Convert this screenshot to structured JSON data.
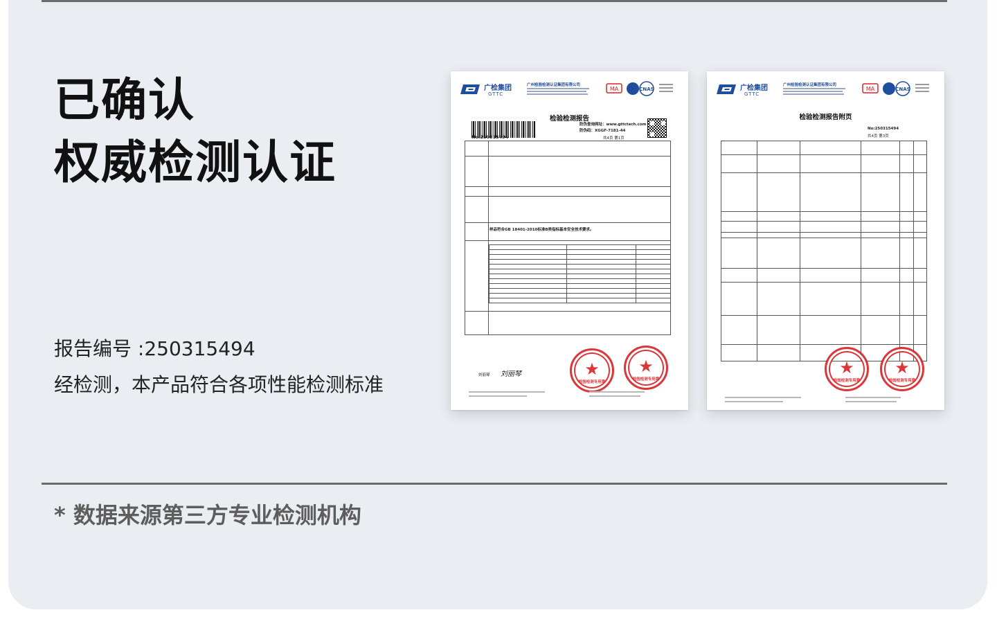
{
  "headline": {
    "line1": "已确认",
    "line2": "权威检测认证"
  },
  "report": {
    "number_line": "报告编号 :250315494",
    "conclusion_line": "经检测，本产品符合各项性能检测标准"
  },
  "footnote": "* 数据来源第三方专业检测机构",
  "documents": [
    {
      "org_short": "广检集团",
      "org_abbr": "GTTC",
      "org_full": "广州检验检测认证集团有限公司",
      "title": "检验检测报告",
      "report_no": "No:250315494",
      "website": "防伪查询网址：www.gttctech.com",
      "anti_fake": "防伪码：XGGF-7181-44",
      "page": "共4页 第1页",
      "conclusion": "样品符合GB 18401-2010标准B类指标基本安全技术要求。",
      "signer": "刘丽琴",
      "stamp_text": "检验检测专用章"
    },
    {
      "org_short": "广检集团",
      "org_abbr": "GTTC",
      "org_full": "广州检验检测认证集团有限公司",
      "title": "检验检测报告附页",
      "report_no": "No:250315494",
      "page": "共4页 第3页",
      "stamp_text": "检验检测专用章"
    }
  ],
  "colors": {
    "panel": "#eaeef3",
    "headline": "#111111",
    "footnote": "#5d5d5d",
    "brand": "#1f4e9e",
    "stamp": "#d9252a"
  }
}
